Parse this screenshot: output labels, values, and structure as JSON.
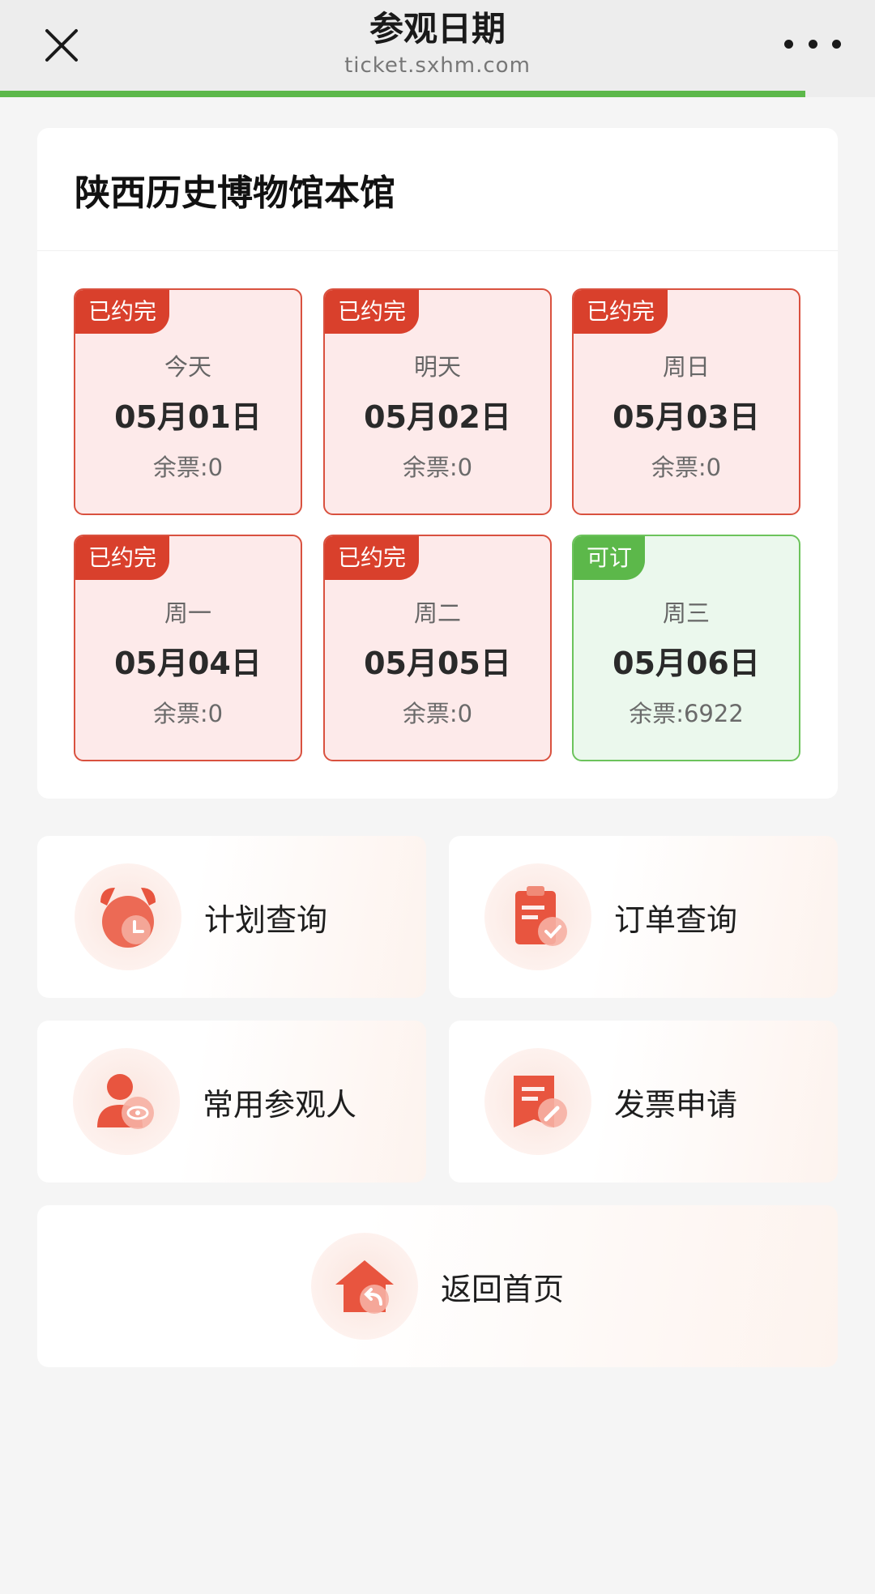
{
  "header": {
    "title": "参观日期",
    "subtitle": "ticket.sxhm.com",
    "load_progress": 0.92
  },
  "museum": {
    "name": "陕西历史博物馆本馆"
  },
  "dates": [
    {
      "tag": "已约完",
      "weekday": "今天",
      "date": "05月01日",
      "remain": "余票:0",
      "status": "full"
    },
    {
      "tag": "已约完",
      "weekday": "明天",
      "date": "05月02日",
      "remain": "余票:0",
      "status": "full"
    },
    {
      "tag": "已约完",
      "weekday": "周日",
      "date": "05月03日",
      "remain": "余票:0",
      "status": "full"
    },
    {
      "tag": "已约完",
      "weekday": "周一",
      "date": "05月04日",
      "remain": "余票:0",
      "status": "full"
    },
    {
      "tag": "已约完",
      "weekday": "周二",
      "date": "05月05日",
      "remain": "余票:0",
      "status": "full"
    },
    {
      "tag": "可订",
      "weekday": "周三",
      "date": "05月06日",
      "remain": "余票:6922",
      "status": "open"
    }
  ],
  "actions": {
    "plan_query": "计划查询",
    "order_query": "订单查询",
    "visitors": "常用参观人",
    "invoice": "发票申请",
    "home": "返回首页"
  },
  "colors": {
    "full_border": "#d9513f",
    "full_tag": "#d9402c",
    "open_border": "#6cc35c",
    "open_tag": "#5cb84a",
    "icon_red": "#e8553f"
  },
  "icons": {
    "close": "close-icon",
    "more": "more-icon",
    "plan": "alarm-clock-icon",
    "order": "clipboard-check-icon",
    "visitors": "person-eye-icon",
    "invoice": "document-edit-icon",
    "home": "house-return-icon"
  }
}
